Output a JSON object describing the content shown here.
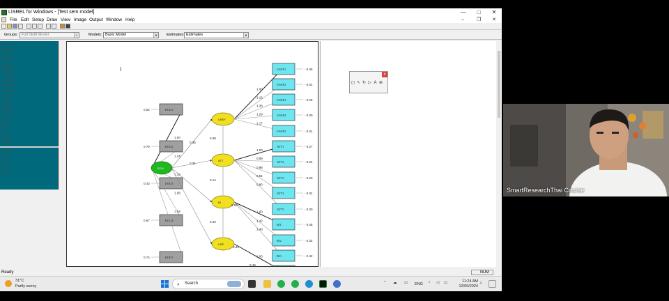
{
  "window": {
    "title": "LISREL for Windows - [Test sem model]",
    "controls": [
      "—",
      "□",
      "✕"
    ]
  },
  "menu": [
    "File",
    "Edit",
    "Setup",
    "Draw",
    "View",
    "Image",
    "Output",
    "Window",
    "Help"
  ],
  "selectors": {
    "groups_label": "Groups:",
    "groups_value": "Full SEM Model",
    "models_label": "Models:",
    "models_value": "Basic Model",
    "estimates_label": "Estimates:",
    "estimates_value": "Estimates"
  },
  "variable_list": {
    "observed": [
      "EOU1",
      "EOU2",
      "EOU3",
      "EOU4",
      "EOU5",
      "USEF1",
      "USEF2",
      "USEF3",
      "USEF4",
      "USEF5",
      "ATT1",
      "ATT2",
      "ATT3",
      "ATT4",
      "ATT5",
      "BI1",
      "BI2",
      "BI3",
      "USE1",
      "USE2"
    ],
    "latent": [
      "USEF",
      "ATT",
      "BI",
      "USE",
      "EOU"
    ]
  },
  "diagram": {
    "eou_indicators": [
      {
        "label": "EOU1",
        "error": "0.02",
        "loading": "1.00"
      },
      {
        "label": "EOU2",
        "error": "0.79",
        "loading": "1.34"
      },
      {
        "label": "EOU3",
        "error": "0.43",
        "loading": "1.16"
      },
      {
        "label": "EOU4",
        "error": "0.67",
        "loading": "1.08"
      },
      {
        "label": "EOU5",
        "error": "0.74",
        "loading": "1.04"
      }
    ],
    "exogenous": {
      "label": "EOU"
    },
    "latents": [
      {
        "label": "USEF"
      },
      {
        "label": "ATT"
      },
      {
        "label": "BI"
      },
      {
        "label": "USE"
      }
    ],
    "structural_paths": [
      "0.36",
      "0.31",
      "0.38",
      "0.14",
      "0.26"
    ],
    "indicators": [
      {
        "label": "USEF1",
        "loading": "1.00",
        "error": "0.35"
      },
      {
        "label": "USEF2",
        "loading": "1.16",
        "error": "0.31"
      },
      {
        "label": "USEF3",
        "loading": "1.38",
        "error": "0.25"
      },
      {
        "label": "USEF4",
        "loading": "1.29",
        "error": "0.30"
      },
      {
        "label": "USEF5",
        "loading": "1.17",
        "error": "0.31"
      },
      {
        "label": "ATT1",
        "loading": "1.00",
        "error": "0.27"
      },
      {
        "label": "ATT2",
        "loading": "0.99",
        "error": "0.24"
      },
      {
        "label": "ATT3",
        "loading": "0.98",
        "error": "0.20"
      },
      {
        "label": "ATT4",
        "loading": "0.91",
        "error": "0.31"
      },
      {
        "label": "ATT5",
        "loading": "0.80",
        "error": "0.30"
      },
      {
        "label": "BI1",
        "loading": "1.00",
        "error": "0.45"
      },
      {
        "label": "BI2",
        "loading": "1.42",
        "error": "0.32"
      },
      {
        "label": "BI3",
        "loading": "1.40",
        "error": "0.42"
      },
      {
        "label": "USE1",
        "loading": "1.00",
        "error": "0.35"
      }
    ],
    "extra_labels": [
      "0.93",
      "0.34",
      "0.49"
    ],
    "colors": {
      "observed": "#6ee6f0",
      "eou_box": "#a0a0a0",
      "latent": "#f0e020",
      "exogenous": "#1fb81f"
    }
  },
  "status": {
    "left": "Ready",
    "num": "NUM"
  },
  "taskbar": {
    "temp": "31°C",
    "weather": "Partly sunny",
    "search": "Search",
    "lang": "ENG",
    "time": "11:24 AM",
    "date": "12/09/2024"
  },
  "webcam": {
    "caption": "SmartResearchThai Course"
  }
}
